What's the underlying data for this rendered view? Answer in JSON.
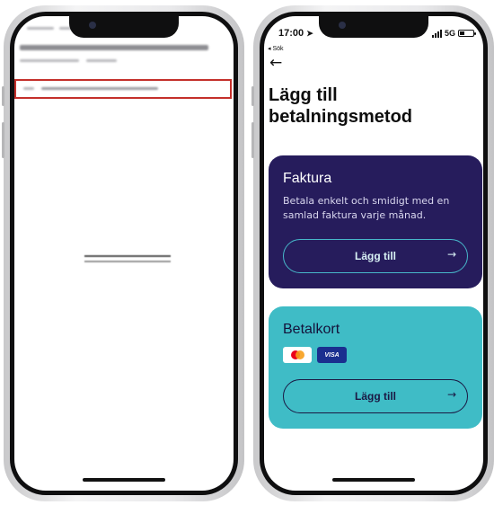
{
  "right_screen": {
    "status_bar": {
      "time": "17:00",
      "network": "5G",
      "back_app": "◂ Sök"
    },
    "title": "Lägg till betalningsmetod",
    "invoice_card": {
      "title": "Faktura",
      "description": "Betala enkelt och smidigt med en samlad faktura varje månad.",
      "button_label": "Lägg till",
      "color": "#261c5c"
    },
    "card_payment": {
      "title": "Betalkort",
      "logos": [
        "mastercard-icon",
        "visa-icon"
      ],
      "visa_label": "VISA",
      "button_label": "Lägg till",
      "color": "#3fbcc6"
    },
    "icons": {
      "back": "back-arrow-icon",
      "button_arrow": "arrow-right-icon"
    }
  },
  "left_screen": {
    "highlight_color": "#c4302b"
  }
}
